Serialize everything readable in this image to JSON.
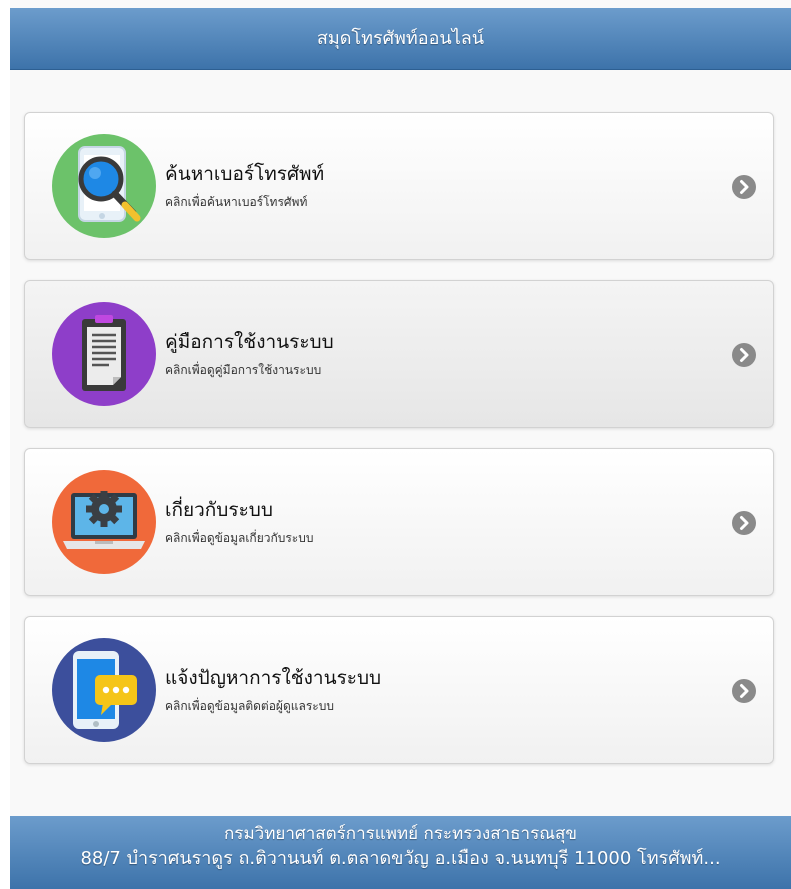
{
  "header": {
    "title": "สมุดโทรศัพท์ออนไลน์"
  },
  "menu": [
    {
      "title": "ค้นหาเบอร์โทรศัพท์",
      "subtitle": "คลิกเพื่อค้นหาเบอร์โทรศัพท์",
      "icon": "phone-search-icon"
    },
    {
      "title": "คู่มือการใช้งานระบบ",
      "subtitle": "คลิกเพื่อดูคู่มือการใช้งานระบบ",
      "icon": "manual-clipboard-icon"
    },
    {
      "title": "เกี่ยวกับระบบ",
      "subtitle": "คลิกเพื่อดูข้อมูลเกี่ยวกับระบบ",
      "icon": "laptop-gear-icon"
    },
    {
      "title": "แจ้งปัญหาการใช้งานระบบ",
      "subtitle": "คลิกเพื่อดูข้อมูลติดต่อผู้ดูแลระบบ",
      "icon": "phone-chat-icon"
    }
  ],
  "footer": {
    "org": "กรมวิทยาศาสตร์การแพทย์ กระทรวงสาธารณสุข",
    "address": "88/7 บำราศนราดูร ถ.ติวานนท์ ต.ตลาดขวัญ อ.เมือง จ.นนทบุรี 11000 โทรศัพท์..."
  },
  "colors": {
    "header": "#4a80b8",
    "icon_search_bg": "#6cc26a",
    "icon_manual_bg": "#8e3ec9",
    "icon_about_bg": "#f0693a",
    "icon_report_bg": "#3c4f9c",
    "chevron": "#8a8a8a"
  }
}
